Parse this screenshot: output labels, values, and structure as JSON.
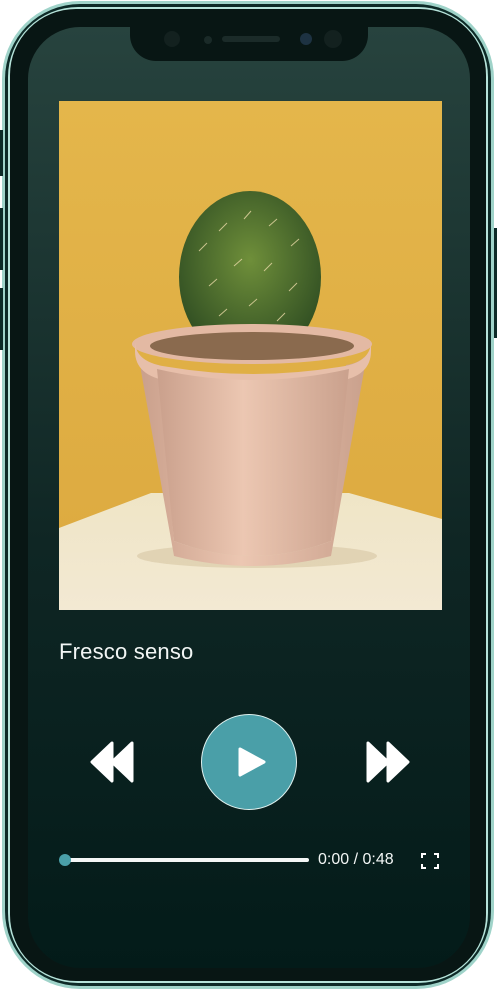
{
  "player": {
    "song_title": "Fresco senso",
    "current_time": "0:00",
    "duration": "0:48",
    "time_separator": " / ",
    "progress_fraction": 0.0
  },
  "artwork": {
    "icon": "cactus-in-pot-photo"
  },
  "controls": {
    "rewind_icon": "rewind-icon",
    "play_icon": "play-icon",
    "forward_icon": "fast-forward-icon",
    "fullscreen_icon": "fullscreen-icon"
  },
  "colors": {
    "accent": "#4a9fa8",
    "background_top": "#27433e",
    "background_bottom": "#031b19",
    "frame": "#9fd3c9",
    "artwork_background": "#e2b54a"
  }
}
